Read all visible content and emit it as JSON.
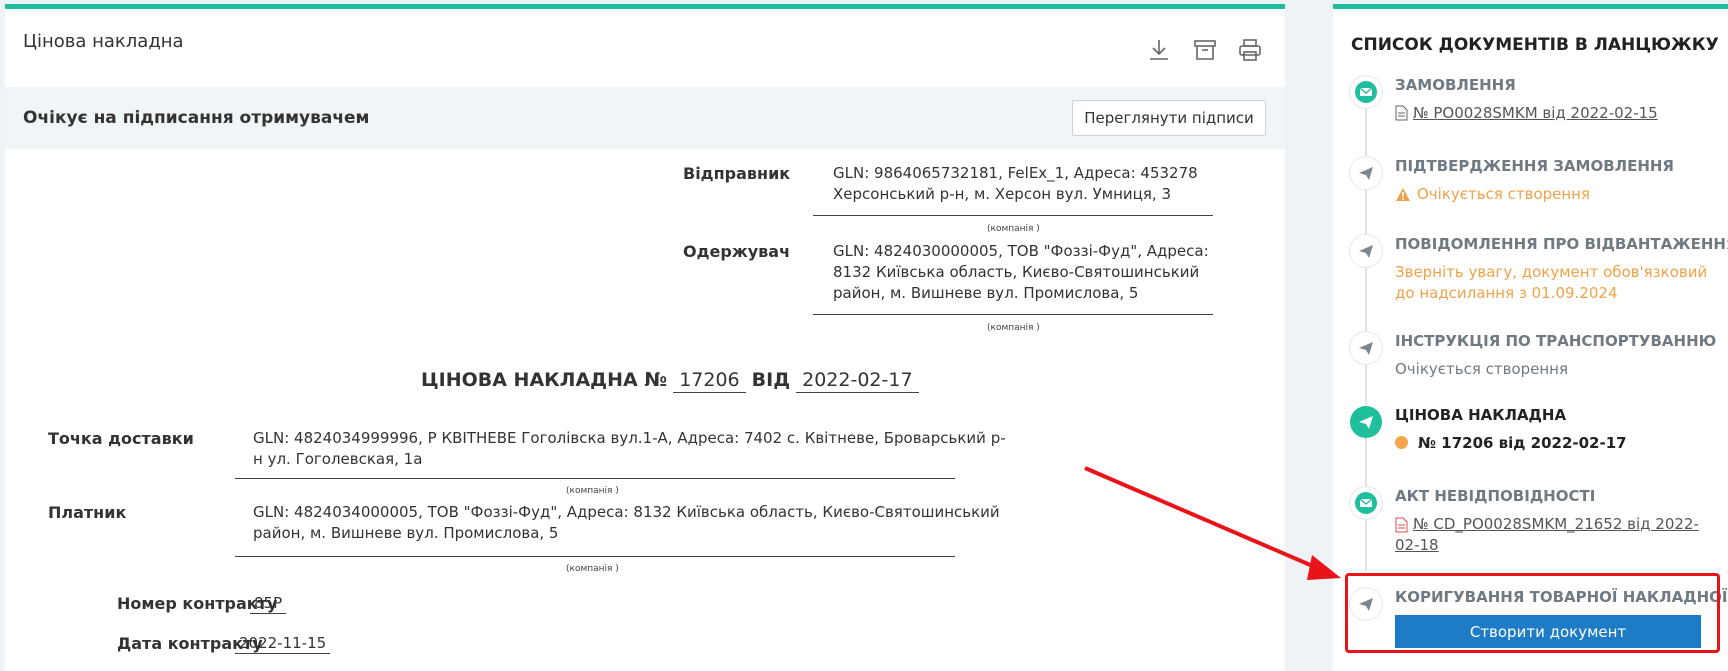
{
  "main": {
    "title": "Цінова накладна",
    "toolbar": {
      "download_icon": "download-icon",
      "archive_icon": "archive-icon",
      "print_icon": "print-icon"
    },
    "status": "Очікує на підписання отримувачем",
    "view_signatures_label": "Переглянути підписи",
    "sender": {
      "label": "Відправник",
      "value_line1": "GLN: 9864065732181, FelEx_1, Адреса: 453278",
      "value_line2": "Херсонський р-н, м. Херсон вул. Умниця, 3",
      "caption": "(компанія )"
    },
    "receiver": {
      "label": "Одержувач",
      "value_line1": "GLN: 4824030000005, ТОВ \"Фоззі-Фуд\", Адреса:",
      "value_line2": "8132 Київська область, Києво-Святошинський",
      "value_line3": "район, м. Вишневе вул. Промислова, 5",
      "caption": "(компанія )"
    },
    "doc_heading": {
      "prefix": "ЦІНОВА НАКЛАДНА №",
      "number": "17206",
      "from_word": "ВІД",
      "date": "2022-02-17"
    },
    "delivery_point": {
      "label": "Точка доставки",
      "value_line1": "GLN: 4824034999996, Р КВІТНЕВЕ Гоголівска вул.1-А, Адреса: 7402 с. Квітневе, Броварський р-",
      "value_line2": "н ул. Гоголевская, 1а",
      "caption": "(компанія )"
    },
    "payer": {
      "label": "Платник",
      "value_line1": "GLN: 4824034000005, ТОВ \"Фоззі-Фуд\", Адреса: 8132 Київська область, Києво-Святошинський",
      "value_line2": "район, м. Вишневе вул. Промислова, 5",
      "caption": "(компанія )"
    },
    "contract_number": {
      "label": "Номер контракту",
      "value": "85Р"
    },
    "contract_date": {
      "label": "Дата контракту",
      "value": "2022-11-15"
    }
  },
  "sidebar": {
    "title": "СПИСОК ДОКУМЕНТІВ В ЛАНЦЮЖКУ",
    "steps": [
      {
        "title": "ЗАМОВЛЕННЯ",
        "icon": "envelope-icon",
        "link": " № PO0028SMKM від 2022-02-15",
        "file_icon": "document-icon"
      },
      {
        "title": "ПІДТВЕРДЖЕННЯ ЗАМОВЛЕННЯ",
        "icon": "send-icon",
        "warning": "Очікується створення",
        "warn_icon": "warning-icon"
      },
      {
        "title": "ПОВІДОМЛЕННЯ ПРО ВІДВАНТАЖЕННЯ",
        "icon": "send-icon",
        "warning_line1": "Зверніть увагу, документ обов'язковий",
        "warning_line2": "до надсилання з 01.09.2024"
      },
      {
        "title": "ІНСТРУКЦІЯ ПО ТРАНСПОРТУВАННЮ",
        "icon": "send-icon",
        "note": "Очікується створення"
      },
      {
        "title": "ЦІНОВА НАКЛАДНА",
        "icon": "send-icon",
        "current": "№ 17206 від 2022-02-17"
      },
      {
        "title": "АКТ НЕВІДПОВІДНОСТІ",
        "icon": "envelope-icon",
        "link_line1": " № CD_PO0028SMKM_21652 від 2022-",
        "link_line2": "02-18",
        "file_icon": "pdf-icon"
      },
      {
        "title": "КОРИГУВАННЯ ТОВАРНОЇ НАКЛАДНОЇ",
        "icon": "send-icon"
      }
    ],
    "create_button_label": "Створити документ"
  },
  "colors": {
    "accent": "#1fbe9d",
    "button_blue": "#1e7cc6",
    "warning": "#f0a24a",
    "highlight": "#e8141a"
  }
}
